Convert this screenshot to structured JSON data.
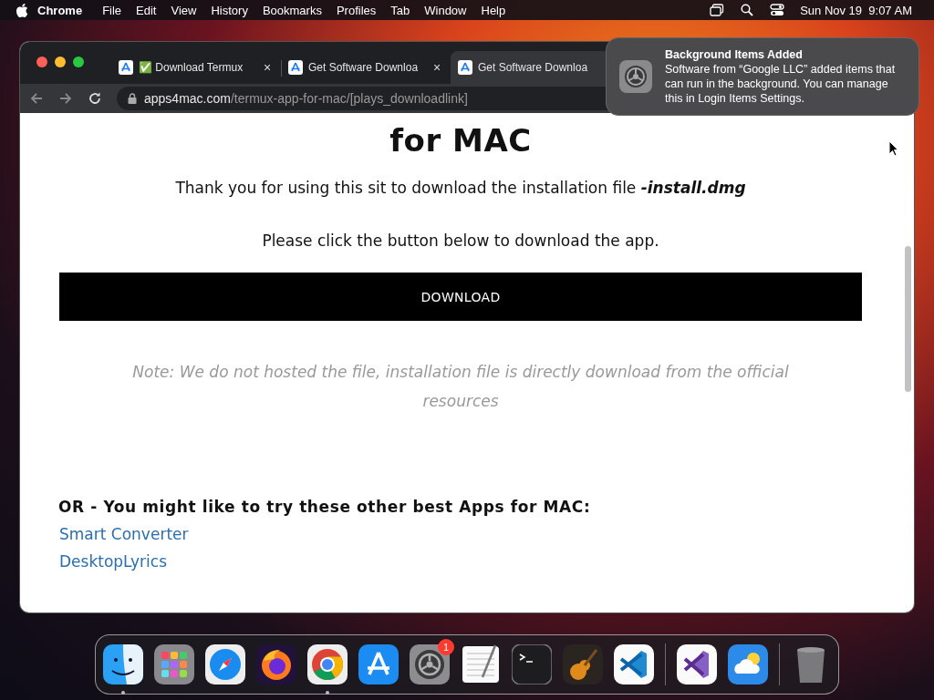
{
  "menu_bar": {
    "app_name": "Chrome",
    "menus": [
      "File",
      "Edit",
      "View",
      "History",
      "Bookmarks",
      "Profiles",
      "Tab",
      "Window",
      "Help"
    ],
    "clock": "Sun Nov 19  9:07 AM"
  },
  "browser": {
    "tabs": [
      {
        "title": "✅ Download Termux",
        "selected": false,
        "close": "×"
      },
      {
        "title": "Get Software Downloa",
        "selected": false,
        "close": "×"
      },
      {
        "title": "Get Software Downloa",
        "selected": true
      }
    ],
    "address": {
      "domain": "apps4mac.com",
      "path": "/termux-app-for-mac/[plays_downloadlink]"
    }
  },
  "page": {
    "heading": "for MAC",
    "thanks": "Thank you for using this sit to download the installation file **-install.dmg**",
    "instruction": "Please click the button below to download the app.",
    "download_button": "DOWNLOAD",
    "note": "Note: We do not hosted the file, installation file is directly download from the official resources",
    "more_heading": "OR - You might like to try these other best Apps for MAC:",
    "links": [
      "Smart Converter",
      "DesktopLyrics"
    ]
  },
  "notification": {
    "title": "Background Items Added",
    "body": "Software from “Google LLC” added items that can run in the background. You can manage this in Login Items Settings."
  },
  "dock": {
    "items": [
      {
        "kind": "finder",
        "running": true
      },
      {
        "kind": "launchpad",
        "running": false
      },
      {
        "kind": "safari",
        "running": false
      },
      {
        "kind": "firefox",
        "running": false
      },
      {
        "kind": "chrome",
        "running": true
      },
      {
        "kind": "appstore",
        "running": false
      },
      {
        "kind": "settings",
        "running": false,
        "badge": "1"
      },
      {
        "kind": "textedit",
        "running": false
      },
      {
        "kind": "terminal",
        "running": false
      },
      {
        "kind": "garageband",
        "running": false
      },
      {
        "kind": "vscode",
        "running": false
      },
      {
        "kind": "separator"
      },
      {
        "kind": "visualstudio",
        "running": false
      },
      {
        "kind": "weather",
        "running": false
      },
      {
        "kind": "separator"
      },
      {
        "kind": "trash",
        "running": false
      }
    ]
  }
}
